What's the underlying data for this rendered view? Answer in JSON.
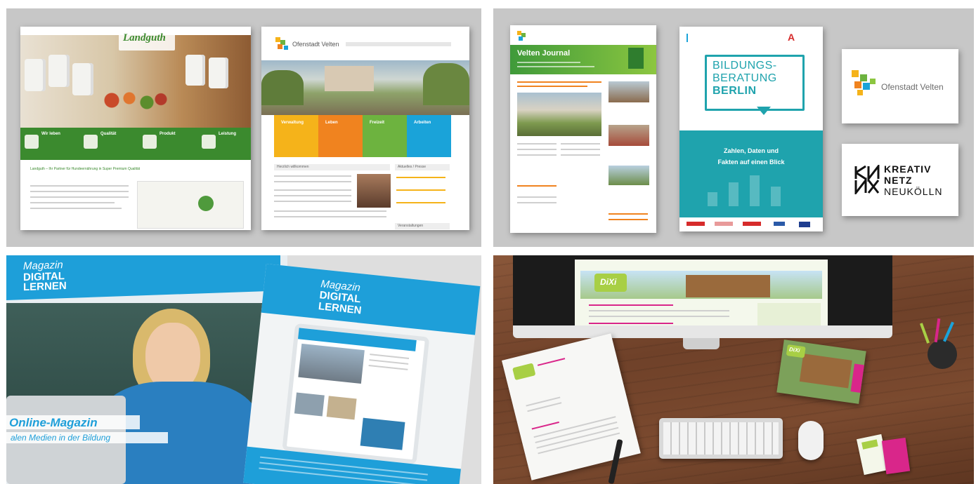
{
  "landguth": {
    "logo_text": "Landguth",
    "headline": "Landguth – Ihr Partner für Hundeernährung in Super Premium Qualität",
    "features": [
      "Wir leben",
      "Qualität",
      "Produkt",
      "Leistung"
    ]
  },
  "velten_site": {
    "logo_text": "Ofenstadt Velten",
    "nav": [
      "Verwaltung",
      "Leben",
      "Freizeit",
      "Arbeiten"
    ],
    "welcome": "Herzlich willkommen",
    "news_heading": "Aktuelles / Presse",
    "events_heading": "Veranstaltungen"
  },
  "journal": {
    "title": "Velten Journal"
  },
  "bildung": {
    "title_lines": [
      "BILDUNGS-",
      "BERATUNG",
      "BERLIN"
    ],
    "subtitle_lines": [
      "Zahlen, Daten und",
      "Fakten auf einen Blick"
    ]
  },
  "logos": {
    "velten": "Ofenstadt Velten",
    "kreativ_lines": [
      "KREATIV",
      "NETZ",
      "NEUKÖLLN"
    ]
  },
  "magazin": {
    "cover_title_lines": [
      "Magazin",
      "DIGITAL",
      "LERNEN"
    ],
    "banner_line1": "Online-Magazin",
    "banner_line2": "alen Medien in der Bildung",
    "second_title_lines": [
      "Magazin",
      "DIGITAL",
      "LERNEN"
    ]
  },
  "desk": {
    "site_logo": "DiXi",
    "flyer_logo": "DiXi"
  },
  "colors": {
    "panel_gray": "#c7c7c7",
    "landguth_green": "#3b8a2e",
    "velten_yellow": "#f5b31a",
    "velten_orange": "#f0831f",
    "velten_green": "#6db33f",
    "velten_blue": "#1aa3d9",
    "bildung_teal": "#1fa3ad",
    "magazin_blue": "#1e9fd9",
    "dixi_green": "#a8cf45",
    "dixi_magenta": "#d9268a",
    "wood": "#7a4a2c"
  }
}
